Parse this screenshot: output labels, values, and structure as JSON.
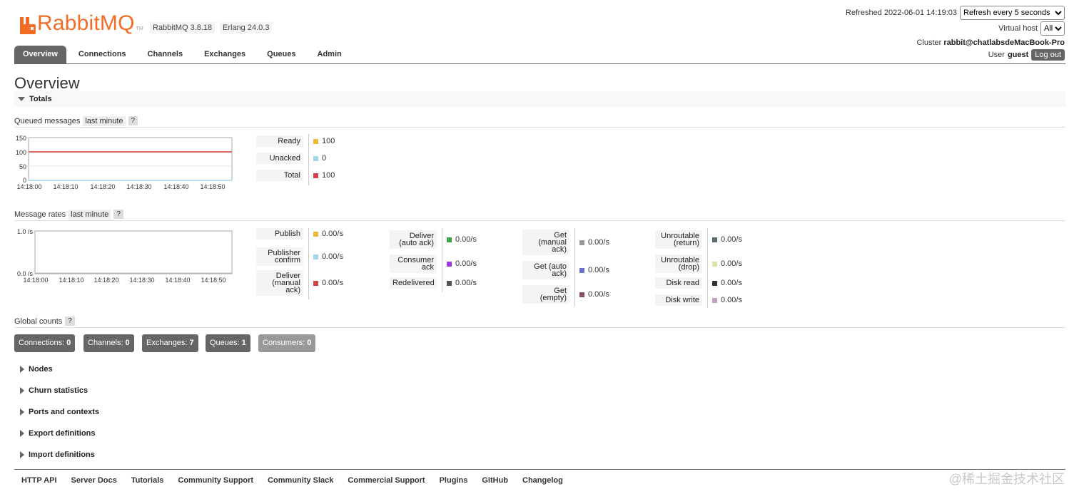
{
  "header": {
    "logo_text": "RabbitMQ",
    "logo_tm": "TM",
    "rabbitmq_version": "RabbitMQ 3.8.18",
    "erlang_version": "Erlang 24.0.3",
    "refreshed_label": "Refreshed 2022-06-01 14:19:03",
    "refresh_select": "Refresh every 5 seconds",
    "vhost_label": "Virtual host",
    "vhost_select": "All",
    "cluster_label": "Cluster",
    "cluster_name": "rabbit@chatlabsdeMacBook-Pro",
    "user_label": "User",
    "user_name": "guest",
    "logout_label": "Log out"
  },
  "tabs": [
    {
      "label": "Overview",
      "active": true
    },
    {
      "label": "Connections"
    },
    {
      "label": "Channels"
    },
    {
      "label": "Exchanges"
    },
    {
      "label": "Queues"
    },
    {
      "label": "Admin"
    }
  ],
  "page_title": "Overview",
  "totals": {
    "title": "Totals",
    "queued_title": "Queued messages",
    "queued_range": "last minute",
    "help": "?",
    "queued_chart": {
      "y_ticks": [
        "150",
        "100",
        "50",
        "0"
      ],
      "y_max": 150,
      "x_ticks": [
        "14:18:00",
        "14:18:10",
        "14:18:20",
        "14:18:30",
        "14:18:40",
        "14:18:50"
      ],
      "total_value": 100,
      "ready_value": 100,
      "unacked_value": 0
    },
    "queued_legend": [
      {
        "label": "Ready",
        "value": "100",
        "color": "#edb83a"
      },
      {
        "label": "Unacked",
        "value": "0",
        "color": "#a5d7ec"
      },
      {
        "label": "Total",
        "value": "100",
        "color": "#d2434c"
      }
    ],
    "rates_title": "Message rates",
    "rates_range": "last minute",
    "rates_chart": {
      "y_ticks": [
        "1.0 /s",
        "0.0 /s"
      ],
      "x_ticks": [
        "14:18:00",
        "14:18:10",
        "14:18:20",
        "14:18:30",
        "14:18:40",
        "14:18:50"
      ]
    },
    "rates_col1": [
      {
        "label_lines": [
          "Publish"
        ],
        "value": "0.00/s",
        "color": "#edb83a"
      },
      {
        "label_lines": [
          "Publisher",
          "confirm"
        ],
        "value": "0.00/s",
        "color": "#a5d7ec"
      },
      {
        "label_lines": [
          "Deliver",
          "(manual",
          "ack)"
        ],
        "value": "0.00/s",
        "color": "#d2434c"
      }
    ],
    "rates_col2": [
      {
        "label_lines": [
          "Deliver",
          "(auto ack)"
        ],
        "value": "0.00/s",
        "color": "#3aa346"
      },
      {
        "label_lines": [
          "Consumer",
          "ack"
        ],
        "value": "0.00/s",
        "color": "#9c3ae0"
      },
      {
        "label_lines": [
          "Redelivered"
        ],
        "value": "0.00/s",
        "color": "#555555"
      }
    ],
    "rates_col3": [
      {
        "label_lines": [
          "Get",
          "(manual",
          "ack)"
        ],
        "value": "0.00/s",
        "color": "#999999"
      },
      {
        "label_lines": [
          "Get (auto",
          "ack)"
        ],
        "value": "0.00/s",
        "color": "#6b6fc7"
      },
      {
        "label_lines": [
          "Get",
          "(empty)"
        ],
        "value": "0.00/s",
        "color": "#8a4e5e"
      }
    ],
    "rates_col4": [
      {
        "label_lines": [
          "Unroutable",
          "(return)"
        ],
        "value": "0.00/s",
        "color": "#5a6b72"
      },
      {
        "label_lines": [
          "Unroutable",
          "(drop)"
        ],
        "value": "0.00/s",
        "color": "#d9e5a8"
      },
      {
        "label_lines": [
          "Disk read"
        ],
        "value": "0.00/s",
        "color": "#333333"
      },
      {
        "label_lines": [
          "Disk write"
        ],
        "value": "0.00/s",
        "color": "#c3a0c2"
      }
    ],
    "global_title": "Global counts",
    "counts": [
      {
        "label": "Connections:",
        "value": "0"
      },
      {
        "label": "Channels:",
        "value": "0"
      },
      {
        "label": "Exchanges:",
        "value": "7"
      },
      {
        "label": "Queues:",
        "value": "1"
      },
      {
        "label": "Consumers:",
        "value": "0"
      }
    ]
  },
  "sections": [
    "Nodes",
    "Churn statistics",
    "Ports and contexts",
    "Export definitions",
    "Import definitions"
  ],
  "footer": [
    "HTTP API",
    "Server Docs",
    "Tutorials",
    "Community Support",
    "Community Slack",
    "Commercial Support",
    "Plugins",
    "GitHub",
    "Changelog"
  ],
  "watermark": "@稀土掘金技术社区"
}
